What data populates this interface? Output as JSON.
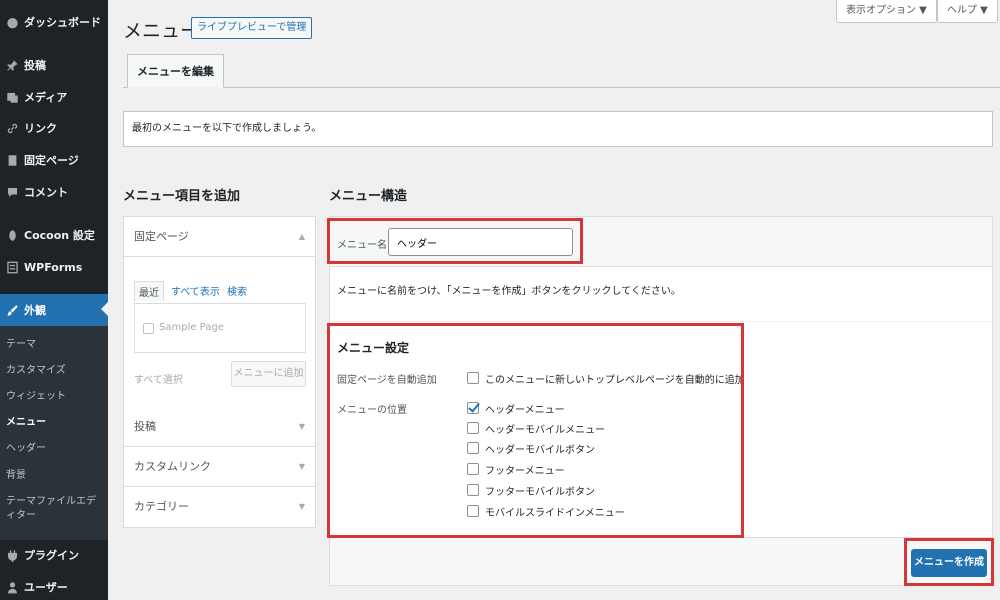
{
  "sidebar": {
    "items": [
      {
        "label": "ダッシュボード",
        "icon": "dashboard-icon"
      },
      {
        "label": "投稿",
        "icon": "pin-icon"
      },
      {
        "label": "メディア",
        "icon": "media-icon"
      },
      {
        "label": "リンク",
        "icon": "link-icon"
      },
      {
        "label": "固定ページ",
        "icon": "page-icon"
      },
      {
        "label": "コメント",
        "icon": "comment-icon"
      },
      {
        "label": "Cocoon 設定",
        "icon": "cocoon-icon"
      },
      {
        "label": "WPForms",
        "icon": "form-icon"
      },
      {
        "label": "外観",
        "icon": "brush-icon"
      },
      {
        "label": "プラグイン",
        "icon": "plugin-icon"
      },
      {
        "label": "ユーザー",
        "icon": "user-icon"
      }
    ],
    "submenu": [
      "テーマ",
      "カスタマイズ",
      "ウィジェット",
      "メニュー",
      "ヘッダー",
      "背景",
      "テーマファイルエディター"
    ],
    "active_color": "#2271b1"
  },
  "header": {
    "title": "メニュー",
    "live_preview": "ライブプレビューで管理",
    "screen_options": "表示オプション ▼",
    "help": "ヘルプ ▼",
    "edit_tab": "メニューを編集"
  },
  "notice": "最初のメニューを以下で作成しましょう。",
  "add_items": {
    "title": "メニュー項目を追加",
    "sections": [
      {
        "label": "固定ページ",
        "arrow": "▲"
      },
      {
        "label": "投稿",
        "arrow": "▼"
      },
      {
        "label": "カスタムリンク",
        "arrow": "▼"
      },
      {
        "label": "カテゴリー",
        "arrow": "▼"
      }
    ],
    "tabs": [
      "最近",
      "すべて表示",
      "検索"
    ],
    "sample_page": "Sample Page",
    "select_all": "すべて選択",
    "add_button": "メニューに追加"
  },
  "structure": {
    "title": "メニュー構造",
    "name_label": "メニュー名",
    "name_value": "ヘッダー",
    "instructions": "メニューに名前をつけ、「メニューを作成」ボタンをクリックしてください。",
    "settings_title": "メニュー設定",
    "auto_add_label": "固定ページを自動追加",
    "auto_add_option": "このメニューに新しいトップレベルページを自動的に追加",
    "location_label": "メニューの位置",
    "locations": [
      {
        "label": "ヘッダーメニュー",
        "checked": true
      },
      {
        "label": "ヘッダーモバイルメニュー",
        "checked": false
      },
      {
        "label": "ヘッダーモバイルボタン",
        "checked": false
      },
      {
        "label": "フッターメニュー",
        "checked": false
      },
      {
        "label": "フッターモバイルボタン",
        "checked": false
      },
      {
        "label": "モバイルスライドインメニュー",
        "checked": false
      }
    ],
    "create_button": "メニューを作成"
  },
  "highlight_color": "#d63638"
}
